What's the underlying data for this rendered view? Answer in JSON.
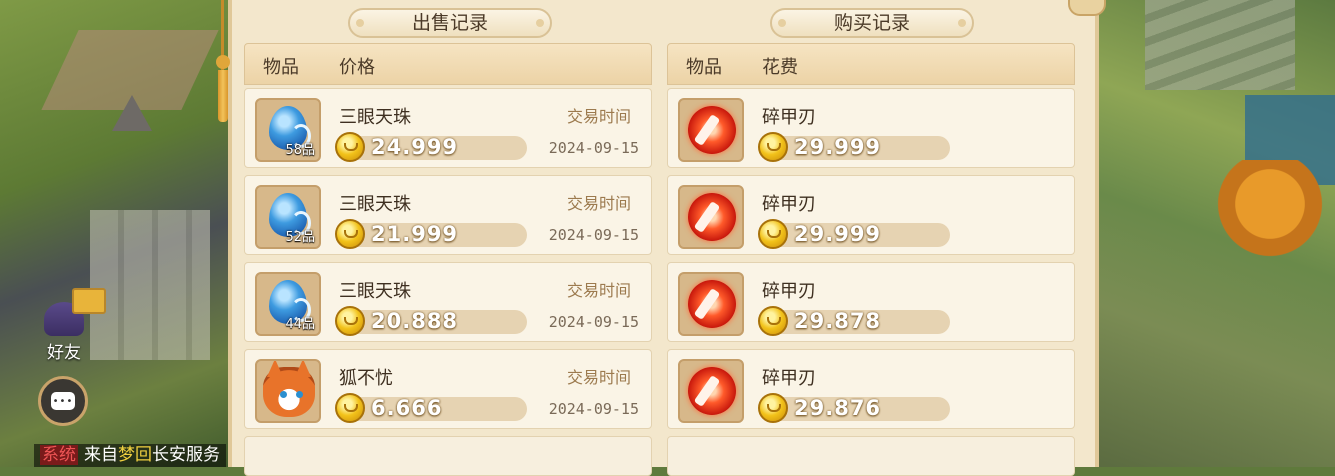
{
  "sell_panel": {
    "title": "出售记录",
    "col_item": "物品",
    "col_price": "价格",
    "rows": [
      {
        "name": "三眼天珠",
        "quality": "58品",
        "price": "24.999",
        "time_label": "交易时间",
        "date": "2024-09-15",
        "icon": "blue-gem-icon"
      },
      {
        "name": "三眼天珠",
        "quality": "52品",
        "price": "21.999",
        "time_label": "交易时间",
        "date": "2024-09-15",
        "icon": "blue-gem-icon"
      },
      {
        "name": "三眼天珠",
        "quality": "44品",
        "price": "20.888",
        "time_label": "交易时间",
        "date": "2024-09-15",
        "icon": "blue-gem-icon"
      },
      {
        "name": "狐不忧",
        "quality": "",
        "price": "6.666",
        "time_label": "交易时间",
        "date": "2024-09-15",
        "icon": "fox-pet-icon"
      }
    ]
  },
  "buy_panel": {
    "title": "购买记录",
    "col_item": "物品",
    "col_cost": "花费",
    "rows": [
      {
        "name": "碎甲刃",
        "price": "29.999",
        "icon": "red-blade-orb-icon"
      },
      {
        "name": "碎甲刃",
        "price": "29.999",
        "icon": "red-blade-orb-icon"
      },
      {
        "name": "碎甲刃",
        "price": "29.878",
        "icon": "red-blade-orb-icon"
      },
      {
        "name": "碎甲刃",
        "price": "29.876",
        "icon": "red-blade-orb-icon"
      }
    ]
  },
  "hud": {
    "friend_label": "好友",
    "ticker_tag": "系统",
    "ticker_prefix": "来自",
    "ticker_highlight": "梦回",
    "ticker_rest": "长安服务"
  }
}
